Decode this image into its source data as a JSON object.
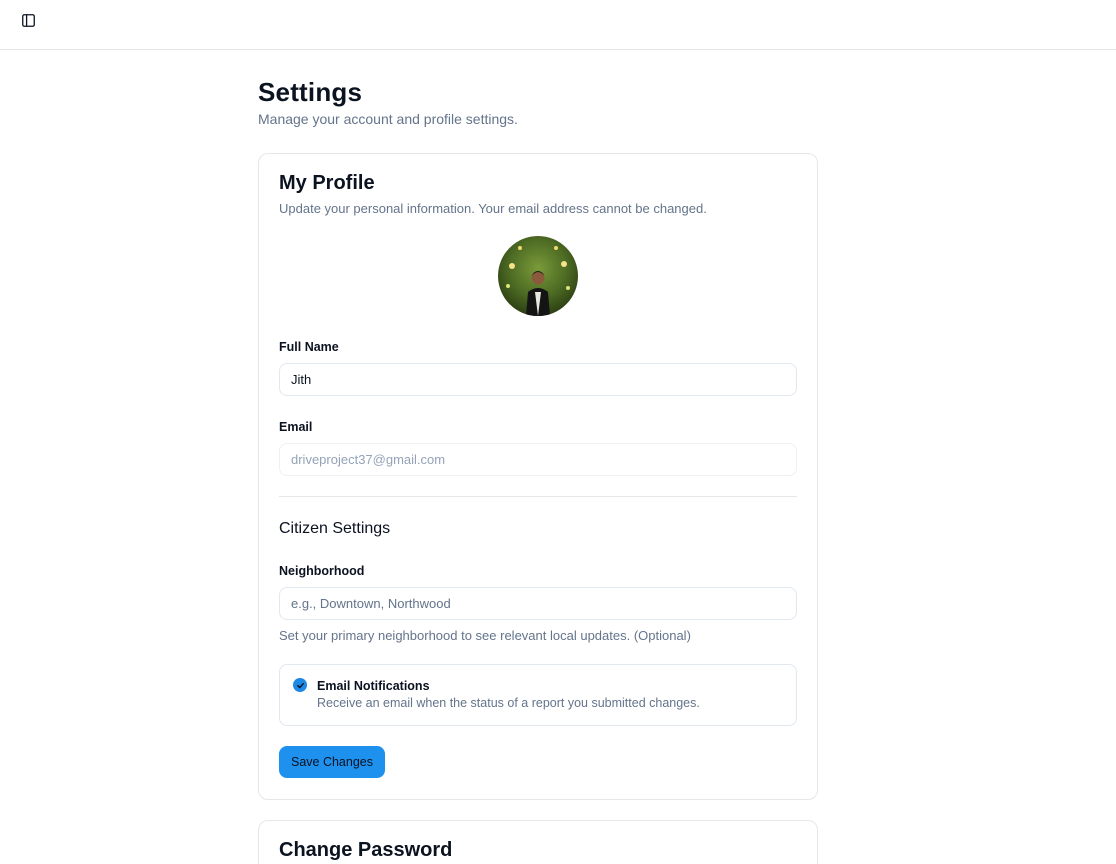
{
  "header": {
    "sidebar_toggle_icon": "sidebar-panel-icon"
  },
  "page": {
    "title": "Settings",
    "subtitle": "Manage your account and profile settings."
  },
  "profile": {
    "title": "My Profile",
    "description": "Update your personal information. Your email address cannot be changed.",
    "avatar_alt": "profile photo",
    "full_name_label": "Full Name",
    "full_name_value": "Jith",
    "email_label": "Email",
    "email_value": "driveproject37@gmail.com"
  },
  "citizen": {
    "title": "Citizen Settings",
    "neighborhood_label": "Neighborhood",
    "neighborhood_value": "",
    "neighborhood_placeholder": "e.g., Downtown, Northwood",
    "neighborhood_hint": "Set your primary neighborhood to see relevant local updates. (Optional)",
    "notifications_title": "Email Notifications",
    "notifications_desc": "Receive an email when the status of a report you submitted changes.",
    "notifications_checked": true,
    "save_label": "Save Changes"
  },
  "password": {
    "title": "Change Password"
  },
  "colors": {
    "accent": "#1e90ee",
    "muted_text": "#64748b",
    "border": "#e5e7eb"
  }
}
